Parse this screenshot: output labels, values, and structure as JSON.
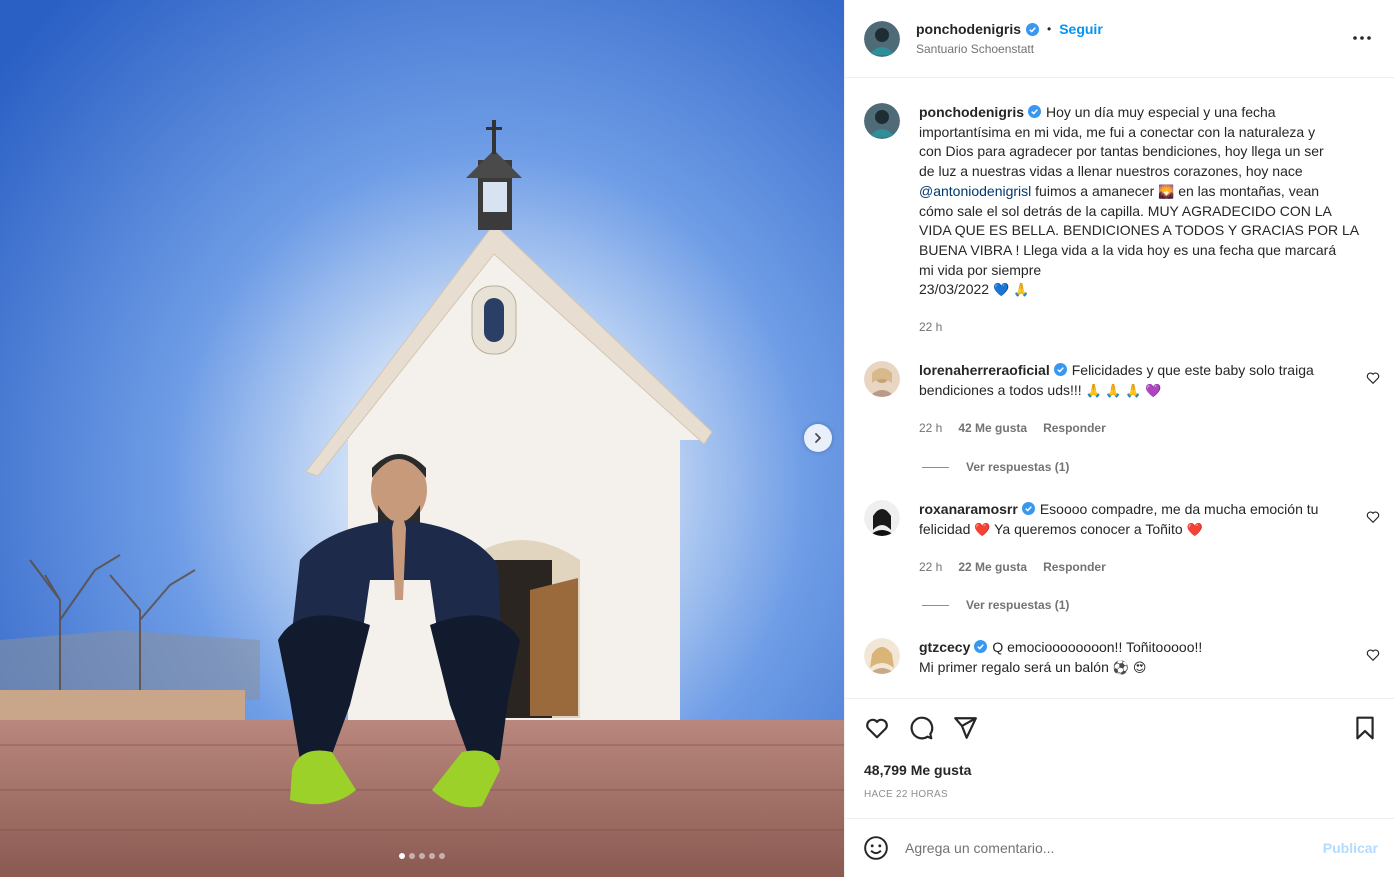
{
  "post": {
    "author": "ponchodenigris",
    "follow_label": "Seguir",
    "separator": "•",
    "location": "Santuario Schoenstatt",
    "caption_lines": [
      "Hoy un día muy especial y una fecha",
      "importantísima en mi vida, me fui a conectar con la naturaleza y",
      "con Dios para agradecer por tantas bendiciones, hoy llega un ser",
      "de luz a nuestras vidas a llenar nuestros corazones, hoy nace"
    ],
    "caption_mention": "@antoniodenigrisl",
    "caption_after_mention": "fuimos a amanecer",
    "caption_after_emoji": "en las montañas, vean",
    "caption_lines_2": [
      "cómo sale el sol detrás de la capilla. MUY AGRADECIDO CON LA",
      "VIDA QUE ES BELLA. BENDICIONES A TODOS Y GRACIAS POR LA",
      "BUENA VIBRA ! Llega vida a la vida hoy es una fecha que marcará",
      "mi vida por siempre"
    ],
    "caption_date": "23/03/2022",
    "caption_time": "22 h"
  },
  "comments": [
    {
      "user": "lorenaherreraoficial",
      "text_1": "Felicidades y que este baby solo traiga",
      "text_2": "bendiciones a todos uds!!!",
      "time": "22 h",
      "likes": "42 Me gusta",
      "reply": "Responder",
      "view_replies": "Ver respuestas (1)"
    },
    {
      "user": "roxanaramosrr",
      "text_1": "Esoooo compadre, me da mucha emoción tu",
      "text_2a": "felicidad",
      "text_2b": "Ya queremos conocer a Toñito",
      "time": "22 h",
      "likes": "22 Me gusta",
      "reply": "Responder",
      "view_replies": "Ver respuestas (1)"
    },
    {
      "user": "gtzcecy",
      "text_1": "Q emocioooooooon!! Toñitooooo!!",
      "text_2": "Mi primer regalo será un balón"
    }
  ],
  "stats": {
    "likes": "48,799 Me gusta",
    "time": "HACE 22 HORAS"
  },
  "composer": {
    "placeholder": "Agrega un comentario...",
    "publish_label": "Publicar"
  },
  "carousel": {
    "count": 5,
    "active_index": 0
  },
  "icons": {
    "verified": "verified-badge-icon",
    "more": "more-options-icon",
    "like": "heart-icon",
    "comment": "comment-icon",
    "share": "share-icon",
    "save": "bookmark-icon",
    "emoji": "emoji-icon",
    "next": "chevron-right-icon"
  },
  "colors": {
    "accent": "#0095f6",
    "verified": "#3897f0",
    "publish_disabled": "#b3dbff",
    "mention": "#00376b"
  }
}
